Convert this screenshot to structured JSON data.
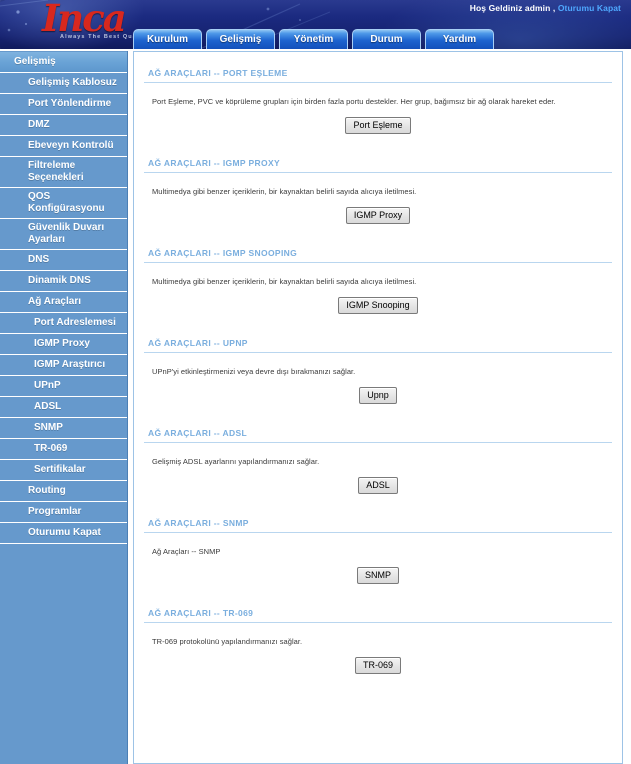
{
  "header": {
    "logo_text": "Inca",
    "logo_tagline": "Always The Best Quality",
    "greeting_prefix": "Hoş Geldiniz admin ,",
    "logout_link": "Oturumu Kapat",
    "tabs": [
      {
        "label": "Kurulum"
      },
      {
        "label": "Gelişmiş"
      },
      {
        "label": "Yönetim"
      },
      {
        "label": "Durum"
      },
      {
        "label": "Yardım"
      }
    ]
  },
  "sidebar": {
    "items": [
      {
        "label": "Gelişmiş",
        "level": "top",
        "active": true
      },
      {
        "label": "Gelişmiş Kablosuz",
        "level": "sub",
        "active": false
      },
      {
        "label": "Port Yönlendirme",
        "level": "sub",
        "active": false
      },
      {
        "label": "DMZ",
        "level": "sub",
        "active": false
      },
      {
        "label": "Ebeveyn Kontrolü",
        "level": "sub",
        "active": false
      },
      {
        "label": "Filtreleme Seçenekleri",
        "level": "sub",
        "active": false
      },
      {
        "label": "QOS Konfigürasyonu",
        "level": "sub",
        "active": false
      },
      {
        "label": "Güvenlik Duvarı Ayarları",
        "level": "sub",
        "active": false
      },
      {
        "label": "DNS",
        "level": "sub",
        "active": false
      },
      {
        "label": "Dinamik DNS",
        "level": "sub",
        "active": false
      },
      {
        "label": "Ağ Araçları",
        "level": "sub",
        "active": false
      },
      {
        "label": "Port Adreslemesi",
        "level": "sub2",
        "active": false
      },
      {
        "label": "IGMP Proxy",
        "level": "sub2",
        "active": false
      },
      {
        "label": "IGMP Araştırıcı",
        "level": "sub2",
        "active": false
      },
      {
        "label": "UPnP",
        "level": "sub2",
        "active": false
      },
      {
        "label": "ADSL",
        "level": "sub2",
        "active": false
      },
      {
        "label": "SNMP",
        "level": "sub2",
        "active": false
      },
      {
        "label": "TR-069",
        "level": "sub2",
        "active": false
      },
      {
        "label": "Sertifikalar",
        "level": "sub2",
        "active": false
      },
      {
        "label": "Routing",
        "level": "sub",
        "active": false
      },
      {
        "label": "Programlar",
        "level": "sub",
        "active": false
      },
      {
        "label": "Oturumu Kapat",
        "level": "sub",
        "active": false
      }
    ]
  },
  "content": {
    "sections": [
      {
        "title": "AĞ ARAÇLARI -- PORT EŞLEME",
        "description": "Port Eşleme, PVC ve köprüleme grupları için birden fazla portu destekler. Her grup, bağımsız bir ağ olarak hareket eder.",
        "button": "Port Eşleme"
      },
      {
        "title": "AĞ ARAÇLARI -- IGMP PROXY",
        "description": "Multimedya gibi benzer içeriklerin, bir kaynaktan belirli sayıda alıcıya iletilmesi.",
        "button": "IGMP Proxy"
      },
      {
        "title": "AĞ ARAÇLARI -- IGMP SNOOPING",
        "description": "Multimedya gibi benzer içeriklerin, bir kaynaktan belirli sayıda alıcıya iletilmesi.",
        "button": "IGMP Snooping"
      },
      {
        "title": "AĞ ARAÇLARI -- UPNP",
        "description": "UPnP'yi etkinleştirmenizi veya devre dışı bırakmanızı sağlar.",
        "button": "Upnp"
      },
      {
        "title": "AĞ ARAÇLARI -- ADSL",
        "description": "Gelişmiş ADSL ayarlarını yapılandırmanızı sağlar.",
        "button": "ADSL"
      },
      {
        "title": "AĞ ARAÇLARI -- SNMP",
        "description": "Ağ Araçları -- SNMP",
        "button": "SNMP"
      },
      {
        "title": "AĞ ARAÇLARI -- TR-069",
        "description": "TR-069 protokolünü yapılandırmanızı sağlar.",
        "button": "TR-069"
      }
    ]
  },
  "colors": {
    "header_blue": "#1b2a80",
    "logo_red": "#d8281e",
    "sidebar_blue": "#6699cc",
    "section_title_blue": "#7aaede",
    "link_blue": "#4fa8ff"
  }
}
